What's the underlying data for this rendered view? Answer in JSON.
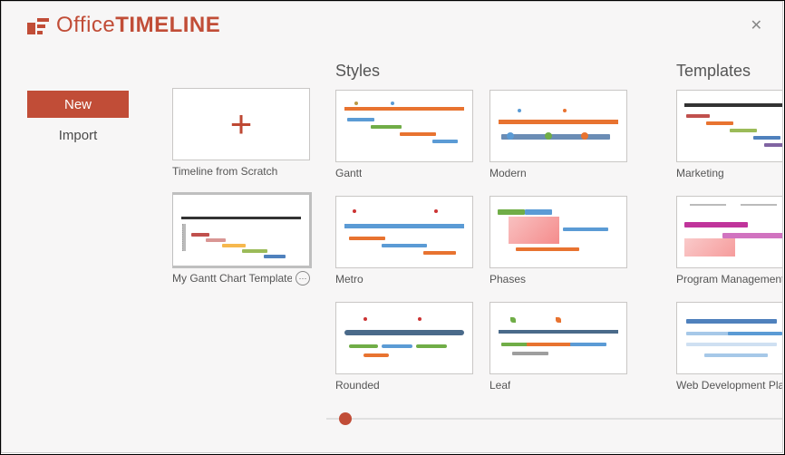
{
  "brand": {
    "first": "Office",
    "second": "TIMELINE"
  },
  "sidebar": {
    "new": "New",
    "import": "Import"
  },
  "sections": {
    "styles": "Styles",
    "templates": "Templates"
  },
  "local": {
    "scratch": "Timeline from Scratch",
    "mytpl": "My Gantt Chart Template"
  },
  "styles": {
    "gantt": "Gantt",
    "modern": "Modern",
    "metro": "Metro",
    "phases": "Phases",
    "rounded": "Rounded",
    "leaf": "Leaf"
  },
  "templates": {
    "marketing": "Marketing",
    "program": "Program Management",
    "webdev": "Web Development Plan"
  },
  "colors": {
    "accent": "#c14d37"
  }
}
